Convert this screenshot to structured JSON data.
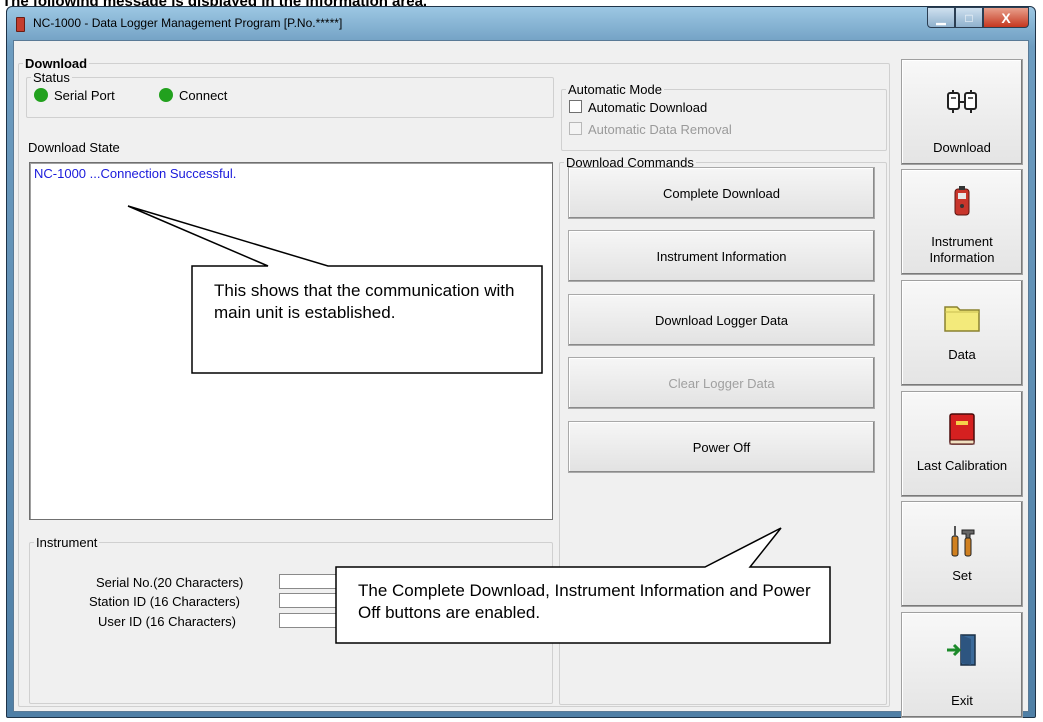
{
  "caption": "The following message is displayed in the information area.",
  "window": {
    "title": "NC-1000 - Data Logger Management Program [P.No.*****]",
    "min_glyph": "▁",
    "max_glyph": "□",
    "close_glyph": "X"
  },
  "download_group": {
    "legend": "Download"
  },
  "status": {
    "legend": "Status",
    "items": [
      {
        "label": "Serial Port",
        "color": "#22a11e"
      },
      {
        "label": "Connect",
        "color": "#22a11e"
      }
    ]
  },
  "download_state": {
    "label": "Download State",
    "lines": [
      "NC-1000 ...Connection Successful."
    ]
  },
  "automatic_mode": {
    "legend": "Automatic Mode",
    "automatic_download": {
      "label": "Automatic Download",
      "checked": false,
      "enabled": true
    },
    "automatic_data_removal": {
      "label": "Automatic Data Removal",
      "checked": false,
      "enabled": false
    }
  },
  "download_commands": {
    "legend": "Download Commands",
    "buttons": [
      {
        "label": "Complete Download",
        "enabled": true
      },
      {
        "label": "Instrument Information",
        "enabled": true
      },
      {
        "label": "Download Logger Data",
        "enabled": true
      },
      {
        "label": "Clear Logger Data",
        "enabled": false
      },
      {
        "label": "Power Off",
        "enabled": true
      }
    ]
  },
  "instrument": {
    "legend": "Instrument",
    "fields": [
      {
        "label": "Serial No.(20 Characters)",
        "value": ""
      },
      {
        "label": "Station ID (16 Characters)",
        "value": ""
      },
      {
        "label": "User ID (16 Characters)",
        "value": ""
      }
    ]
  },
  "sidebar": [
    {
      "label": "Download",
      "icon": "download-icon"
    },
    {
      "label": "Instrument Information",
      "icon": "instrument-icon"
    },
    {
      "label": "Data",
      "icon": "folder-icon"
    },
    {
      "label": "Last Calibration",
      "icon": "book-icon"
    },
    {
      "label": "Set",
      "icon": "tools-icon"
    },
    {
      "label": "Exit",
      "icon": "exit-door-icon"
    }
  ],
  "callouts": [
    {
      "text": "This shows that the communication with main unit is established."
    },
    {
      "text": "The Complete Download, Instrument Information and Power Off buttons are enabled."
    }
  ]
}
